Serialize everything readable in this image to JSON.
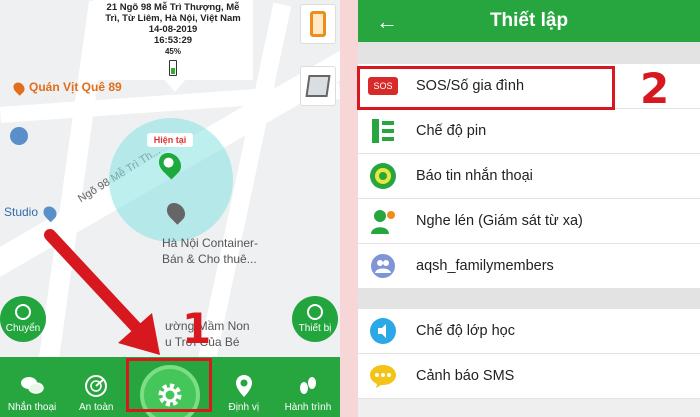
{
  "left_panel": {
    "info_card": {
      "address_line1": "21 Ngõ 98 Mễ Trì Thượng, Mễ",
      "address_line2": "Trì, Từ Liêm, Hà Nội, Việt Nam",
      "date": "14-08-2019",
      "time": "16:53:29",
      "battery": "45%"
    },
    "map_labels": {
      "road": "Ngõ 98 Mễ Trì Th...",
      "restaurant": "Quán Vịt Quê 89",
      "studio": "Studio",
      "container_line1": "Hà Nội Container-",
      "container_line2": "Bán & Cho thuê...",
      "school_line1": "ường Mầm Non",
      "school_line2": "u Trời Của Bé",
      "current_location": "Hiện tại"
    },
    "side_buttons": {
      "left": "Chuyển",
      "right": "Thiết bị"
    },
    "bottom_nav": [
      {
        "label": "Nhắn thoại",
        "icon": "chat-icon"
      },
      {
        "label": "An toàn",
        "icon": "radar-icon"
      },
      {
        "label": "",
        "icon": "gear-icon"
      },
      {
        "label": "Định vị",
        "icon": "location-pin-icon"
      },
      {
        "label": "Hành trình",
        "icon": "footprints-icon"
      }
    ],
    "step_number": "1"
  },
  "right_panel": {
    "title": "Thiết lập",
    "sections": [
      [
        {
          "label": "SOS/Số gia đình",
          "icon": "sos-icon",
          "badge": "SOS"
        },
        {
          "label": "Chế độ pin",
          "icon": "battery-mode-icon"
        },
        {
          "label": "Báo tin nhắn thoại",
          "icon": "voice-message-icon"
        },
        {
          "label": "Nghe lén (Giám sát từ xa)",
          "icon": "remote-listen-icon"
        },
        {
          "label": "aqsh_familymembers",
          "icon": "family-members-icon"
        }
      ],
      [
        {
          "label": "Chế độ lớp học",
          "icon": "class-mode-icon"
        },
        {
          "label": "Cảnh báo SMS",
          "icon": "sms-alert-icon"
        }
      ]
    ],
    "step_number": "2"
  },
  "colors": {
    "brand_green": "#27a640",
    "highlight_red": "#d8181f"
  }
}
